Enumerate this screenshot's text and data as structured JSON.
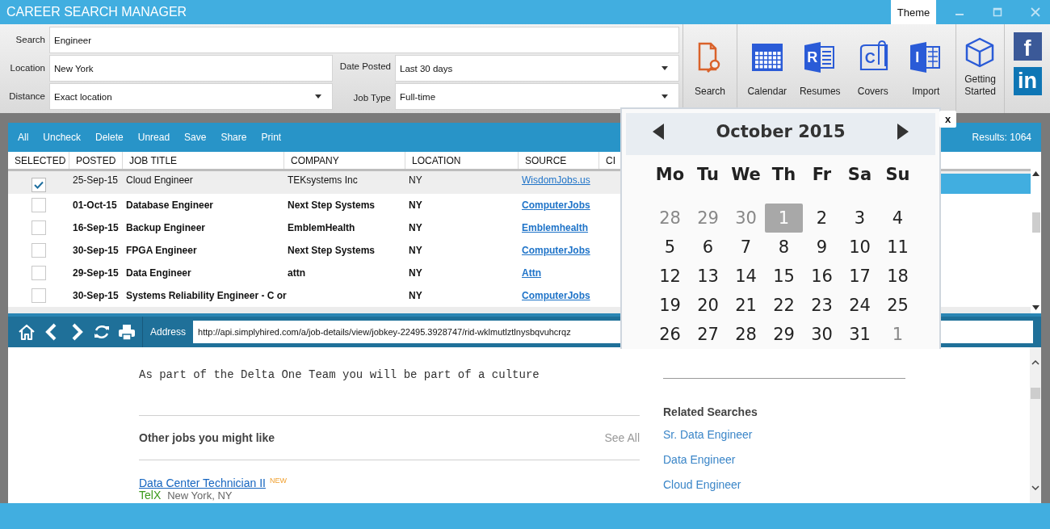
{
  "window": {
    "title": "CAREER SEARCH MANAGER",
    "theme_button": "Theme"
  },
  "search_form": {
    "fields": [
      {
        "kind": "text",
        "label": "Search",
        "value": "Engineer"
      },
      {
        "kind": "text",
        "label": "Location",
        "value": "New York"
      },
      {
        "kind": "dropdown",
        "label": "Distance",
        "value": "Exact location"
      },
      {
        "kind": "dropdown",
        "label": "Date Posted",
        "value": "Last 30 days"
      },
      {
        "kind": "dropdown",
        "label": "Job Type",
        "value": "Full-time"
      }
    ]
  },
  "toolbar": {
    "groups": [
      [
        {
          "kind": "search",
          "label": "Search"
        }
      ],
      [
        {
          "kind": "calendar",
          "label": "Calendar"
        },
        {
          "kind": "resumes",
          "label": "Resumes",
          "letter": "R"
        },
        {
          "kind": "covers",
          "label": "Covers",
          "letter": "C"
        },
        {
          "kind": "import",
          "label": "Import",
          "letter": "I"
        }
      ],
      [
        {
          "kind": "cube",
          "label": "Getting Started"
        }
      ]
    ],
    "social": [
      {
        "kind": "facebook",
        "letter": "f"
      },
      {
        "kind": "linkedin",
        "letter": "in"
      }
    ]
  },
  "grid_toolbar": {
    "actions": [
      "All",
      "Uncheck",
      "Delete",
      "Unread",
      "Save",
      "Share",
      "Print"
    ],
    "results": "Results: 1064"
  },
  "table": {
    "columns": [
      "SELECTED",
      "POSTED",
      "JOB TITLE",
      "COMPANY",
      "LOCATION",
      "SOURCE",
      "CI"
    ],
    "rows": [
      {
        "selected": true,
        "checked": true,
        "unread": false,
        "posted": "25-Sep-15",
        "job_title": "Cloud Engineer",
        "company": "TEKsystems Inc",
        "location": "NY",
        "source": "WisdomJobs.us"
      },
      {
        "selected": false,
        "checked": false,
        "unread": true,
        "posted": "01-Oct-15",
        "job_title": "Database Engineer",
        "company": "Next Step Systems",
        "location": "NY",
        "source": "ComputerJobs"
      },
      {
        "selected": false,
        "checked": false,
        "unread": true,
        "posted": "16-Sep-15",
        "job_title": "Backup Engineer",
        "company": "EmblemHealth",
        "location": "NY",
        "source": "Emblemhealth"
      },
      {
        "selected": false,
        "checked": false,
        "unread": true,
        "posted": "30-Sep-15",
        "job_title": "FPGA Engineer",
        "company": "Next Step Systems",
        "location": "NY",
        "source": "ComputerJobs"
      },
      {
        "selected": false,
        "checked": false,
        "unread": true,
        "posted": "29-Sep-15",
        "job_title": "Data Engineer",
        "company": "attn",
        "location": "NY",
        "source": "Attn"
      },
      {
        "selected": false,
        "checked": false,
        "unread": true,
        "posted": "30-Sep-15",
        "job_title": "Systems Reliability Engineer - C or",
        "company": "",
        "location": "NY",
        "source": "ComputerJobs"
      }
    ]
  },
  "browser": {
    "address_label": "Address",
    "url": "http://api.simplyhired.com/a/job-details/view/jobkey-22495.3928747/rid-wklmutlztlnysbqvuhcrqz",
    "description": "As part of the Delta One Team you will be part of a culture",
    "other_jobs_title": "Other jobs you might like",
    "see_all": "See All",
    "job": {
      "title": "Data Center Technician II",
      "badge": "NEW",
      "company": "TelX",
      "place": "New York, NY"
    },
    "related_title": "Related Searches",
    "related": [
      "Sr. Data Engineer",
      "Data Engineer",
      "Cloud Engineer"
    ]
  },
  "calendar": {
    "title": "October 2015",
    "close": "x",
    "weekdays": [
      "Mo",
      "Tu",
      "We",
      "Th",
      "Fr",
      "Sa",
      "Su"
    ],
    "days": [
      {
        "label": "28",
        "other_month": true,
        "selected": false
      },
      {
        "label": "29",
        "other_month": true,
        "selected": false
      },
      {
        "label": "30",
        "other_month": true,
        "selected": false
      },
      {
        "label": "1",
        "other_month": false,
        "selected": true
      },
      {
        "label": "2",
        "other_month": false,
        "selected": false
      },
      {
        "label": "3",
        "other_month": false,
        "selected": false
      },
      {
        "label": "4",
        "other_month": false,
        "selected": false
      },
      {
        "label": "5",
        "other_month": false,
        "selected": false
      },
      {
        "label": "6",
        "other_month": false,
        "selected": false
      },
      {
        "label": "7",
        "other_month": false,
        "selected": false
      },
      {
        "label": "8",
        "other_month": false,
        "selected": false
      },
      {
        "label": "9",
        "other_month": false,
        "selected": false
      },
      {
        "label": "10",
        "other_month": false,
        "selected": false
      },
      {
        "label": "11",
        "other_month": false,
        "selected": false
      },
      {
        "label": "12",
        "other_month": false,
        "selected": false
      },
      {
        "label": "13",
        "other_month": false,
        "selected": false
      },
      {
        "label": "14",
        "other_month": false,
        "selected": false
      },
      {
        "label": "15",
        "other_month": false,
        "selected": false
      },
      {
        "label": "16",
        "other_month": false,
        "selected": false
      },
      {
        "label": "17",
        "other_month": false,
        "selected": false
      },
      {
        "label": "18",
        "other_month": false,
        "selected": false
      },
      {
        "label": "19",
        "other_month": false,
        "selected": false
      },
      {
        "label": "20",
        "other_month": false,
        "selected": false
      },
      {
        "label": "21",
        "other_month": false,
        "selected": false
      },
      {
        "label": "22",
        "other_month": false,
        "selected": false
      },
      {
        "label": "23",
        "other_month": false,
        "selected": false
      },
      {
        "label": "24",
        "other_month": false,
        "selected": false
      },
      {
        "label": "25",
        "other_month": false,
        "selected": false
      },
      {
        "label": "26",
        "other_month": false,
        "selected": false
      },
      {
        "label": "27",
        "other_month": false,
        "selected": false
      },
      {
        "label": "28",
        "other_month": false,
        "selected": false
      },
      {
        "label": "29",
        "other_month": false,
        "selected": false
      },
      {
        "label": "30",
        "other_month": false,
        "selected": false
      },
      {
        "label": "31",
        "other_month": false,
        "selected": false
      },
      {
        "label": "1",
        "other_month": true,
        "selected": false
      }
    ]
  }
}
